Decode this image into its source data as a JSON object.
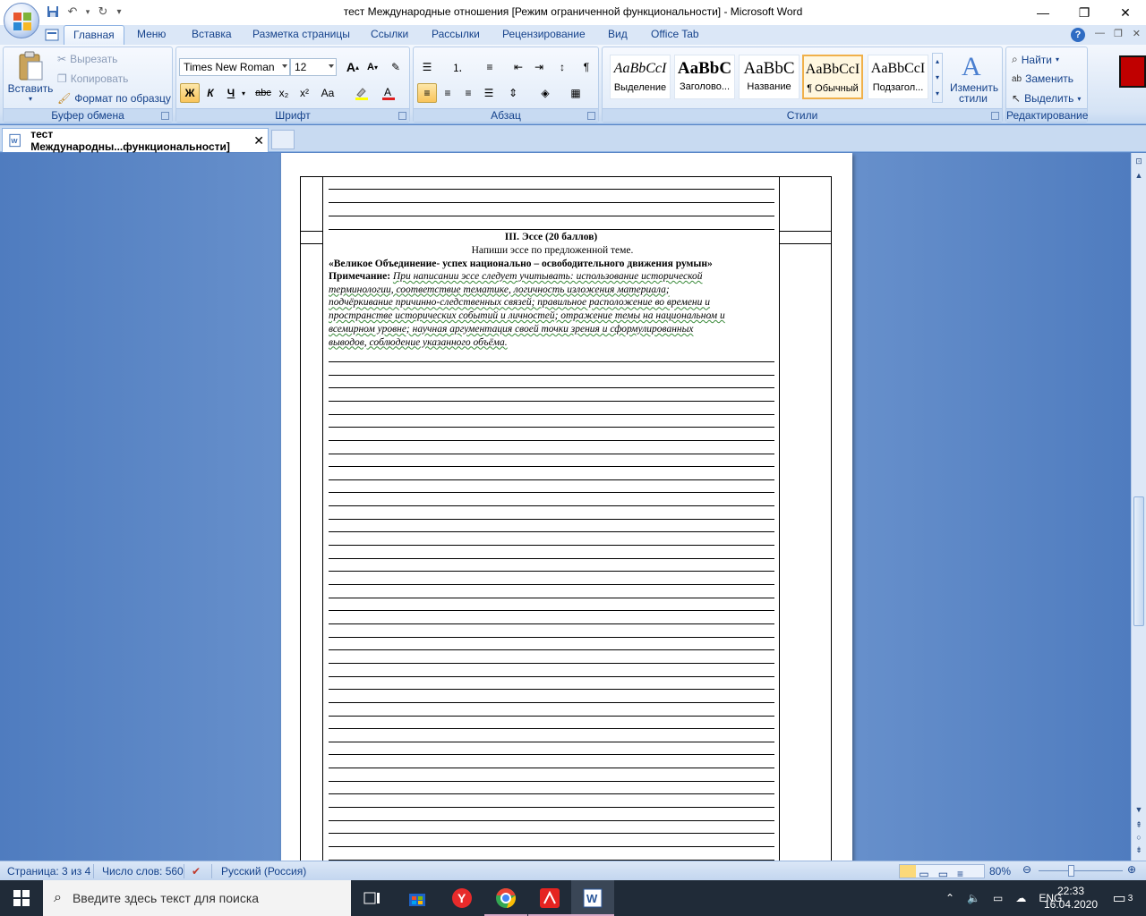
{
  "window": {
    "title": "тест Международные отношения [Режим ограниченной функциональности] - Microsoft Word",
    "qat": {
      "save": "save-icon",
      "undo": "undo-icon",
      "redo": "redo-icon",
      "customize": "▾"
    }
  },
  "ribbon_tabs": [
    "Главная",
    "Меню",
    "Вставка",
    "Разметка страницы",
    "Ссылки",
    "Рассылки",
    "Рецензирование",
    "Вид",
    "Office Tab"
  ],
  "clipboard": {
    "label": "Буфер обмена",
    "paste": "Вставить",
    "cut": "Вырезать",
    "copy": "Копировать",
    "format_painter": "Формат по образцу"
  },
  "font": {
    "label": "Шрифт",
    "family": "Times New Roman",
    "size": "12",
    "bold": "Ж",
    "italic": "К",
    "underline": "Ч",
    "strike": "abc",
    "subscript": "x₂",
    "superscript": "x²",
    "case": "Aa",
    "grow": "A",
    "shrink": "A"
  },
  "paragraph": {
    "label": "Абзац"
  },
  "styles": {
    "label": "Стили",
    "items": [
      {
        "sample": "AaBbCcI",
        "name": "Выделение"
      },
      {
        "sample": "AaBbC",
        "name": "Заголово..."
      },
      {
        "sample": "AaBbC",
        "name": "Название"
      },
      {
        "sample": "AaBbCcI",
        "name": "¶ Обычный"
      },
      {
        "sample": "AaBbCcI",
        "name": "Подзагол..."
      }
    ],
    "change": "Изменить стили"
  },
  "editing": {
    "label": "Редактирование",
    "find": "Найти",
    "replace": "Заменить",
    "select": "Выделить"
  },
  "doc_tab": {
    "title": "тест Международны...функциональности]",
    "close": "✕"
  },
  "document": {
    "section_title": "III. Эссе (20 баллов)",
    "instruction": "Напиши эссе по предложенной теме.",
    "topic": "«Великое Объединение- успех национально – освободительного движения румын»",
    "note_label": "Примечание:",
    "note_lines": [
      "При написании эссе следует учитывать: использование исторической",
      "терминологии, соответствие тематике, логичность изложения материала;",
      "подчёркивание причинно-следственных связей; правильное расположение во времени и",
      "пространстве исторических событий и личностей; отражение темы на национальном и",
      "всемирном уровне; научная аргументация своей точки зрения и сформулированных",
      "выводов, соблюдение указанного объёма."
    ]
  },
  "status": {
    "page": "Страница: 3 из 4",
    "words": "Число слов: 560",
    "language": "Русский (Россия)",
    "zoom": "80%"
  },
  "taskbar": {
    "search_placeholder": "Введите здесь текст для поиска",
    "lang": "ENG",
    "time": "22:33",
    "date": "16.04.2020",
    "notifications": "3"
  }
}
